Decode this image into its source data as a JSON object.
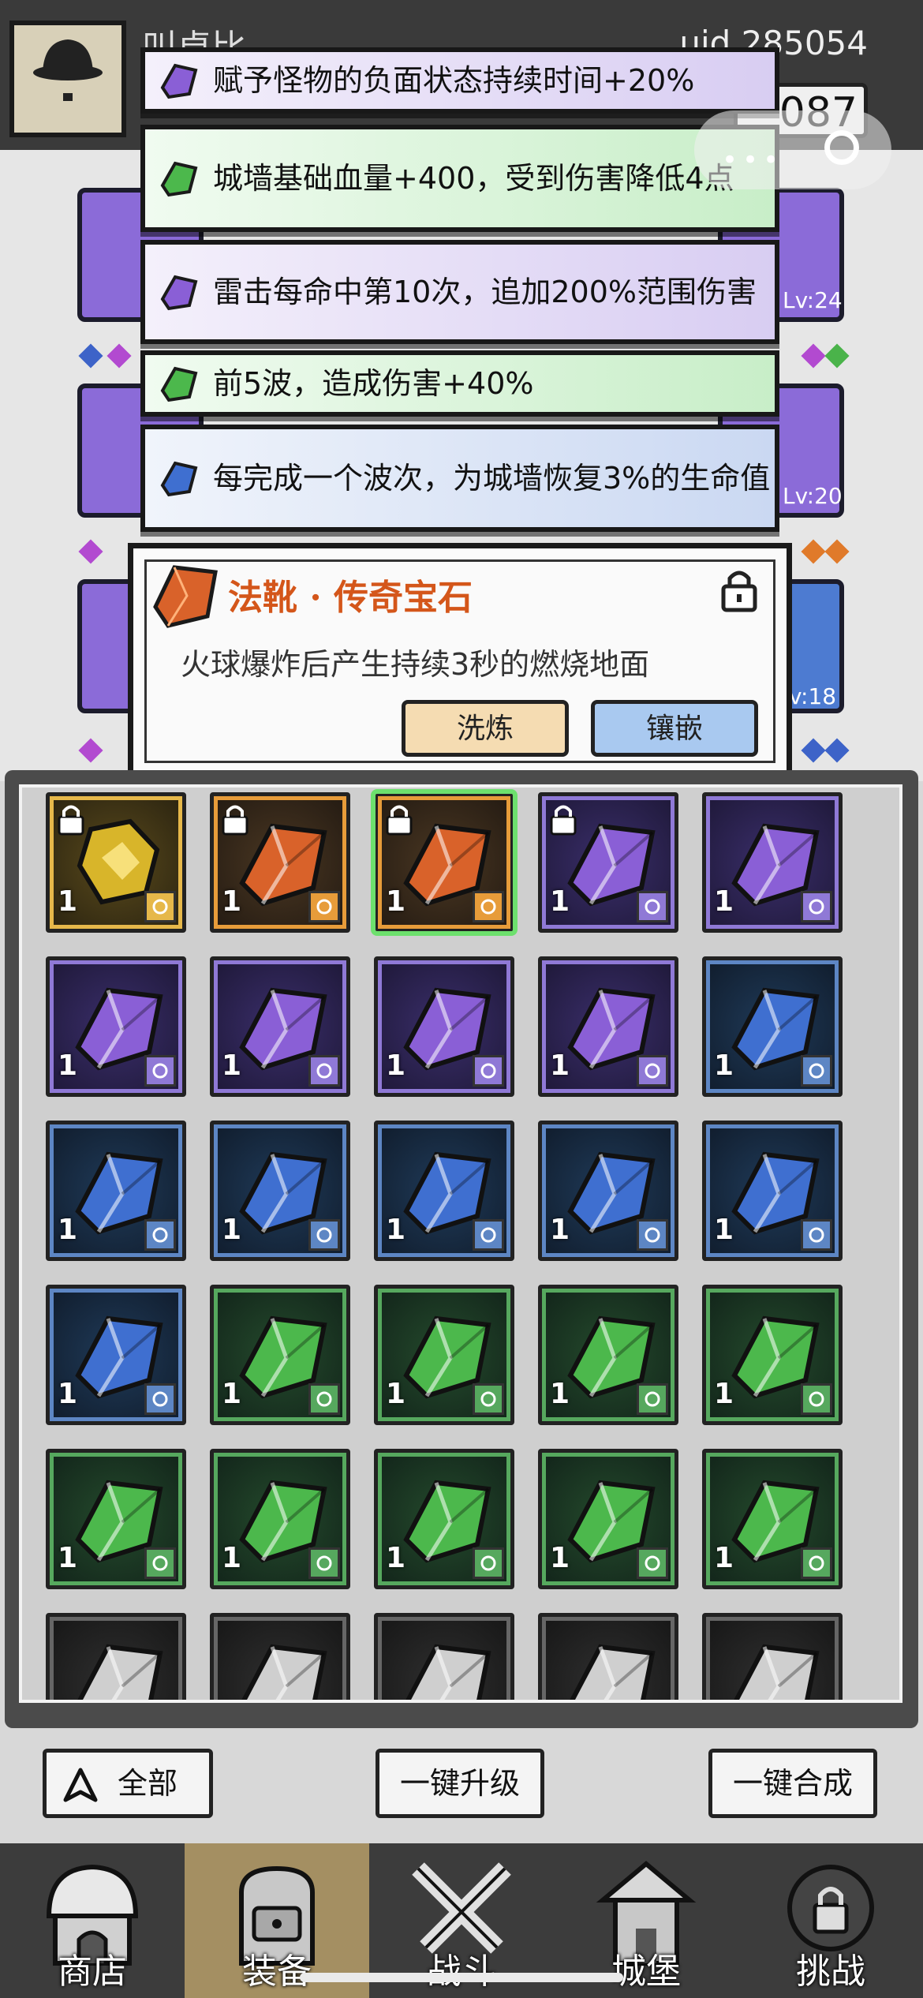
{
  "header": {
    "player_name": "叫卓比",
    "uid": "uid 285054",
    "currency": "087"
  },
  "affixes": [
    {
      "color": "purple",
      "text": "赋予怪物的负面状态持续时间+20%"
    },
    {
      "color": "green",
      "text": "城墙基础血量+400，受到伤害降低4点"
    },
    {
      "color": "purple",
      "text": "雷击每命中第10次，追加200%范围伤害"
    },
    {
      "color": "green",
      "text": "前5波，造成伤害+40%"
    },
    {
      "color": "blue",
      "text": "每完成一个波次，为城墙恢复3%的生命值"
    }
  ],
  "equipment_levels": [
    "Lv:24",
    "Lv:20",
    "v:18"
  ],
  "gem_dialog": {
    "title": "法靴 · 传奇宝石",
    "description": "火球爆炸后产生持续3秒的燃烧地面",
    "refine_label": "洗炼",
    "inlay_label": "镶嵌",
    "locked": true
  },
  "inventory": {
    "rows": [
      [
        {
          "rarity": "gold",
          "count": "1",
          "slot": "ring",
          "locked": true
        },
        {
          "rarity": "orange",
          "count": "1",
          "slot": "ring",
          "locked": true
        },
        {
          "rarity": "orange",
          "count": "1",
          "slot": "boots",
          "locked": true,
          "selected": true
        },
        {
          "rarity": "purple",
          "count": "1",
          "slot": "ring",
          "locked": true
        },
        {
          "rarity": "purple",
          "count": "1",
          "slot": "armor",
          "locked": false
        }
      ],
      [
        {
          "rarity": "purple",
          "count": "1",
          "slot": "armor"
        },
        {
          "rarity": "purple",
          "count": "1",
          "slot": "hat"
        },
        {
          "rarity": "purple",
          "count": "1",
          "slot": "hat"
        },
        {
          "rarity": "purple",
          "count": "1",
          "slot": "necklace"
        },
        {
          "rarity": "blue",
          "count": "1",
          "slot": "ring"
        }
      ],
      [
        {
          "rarity": "blue",
          "count": "1",
          "slot": "armor"
        },
        {
          "rarity": "blue",
          "count": "1",
          "slot": "staff"
        },
        {
          "rarity": "blue",
          "count": "1",
          "slot": "hat"
        },
        {
          "rarity": "blue",
          "count": "1",
          "slot": "hat"
        },
        {
          "rarity": "blue",
          "count": "1",
          "slot": "hat"
        }
      ],
      [
        {
          "rarity": "blue",
          "count": "1",
          "slot": "necklace"
        },
        {
          "rarity": "green",
          "count": "1",
          "slot": "ring"
        },
        {
          "rarity": "green",
          "count": "1",
          "slot": "armor"
        },
        {
          "rarity": "green",
          "count": "1",
          "slot": "armor"
        },
        {
          "rarity": "green",
          "count": "1",
          "slot": "armor"
        }
      ],
      [
        {
          "rarity": "green",
          "count": "1",
          "slot": "boots"
        },
        {
          "rarity": "green",
          "count": "1",
          "slot": "boots"
        },
        {
          "rarity": "green",
          "count": "1",
          "slot": "boots"
        },
        {
          "rarity": "green",
          "count": "1",
          "slot": "hat"
        },
        {
          "rarity": "green",
          "count": "1",
          "slot": "hat"
        }
      ],
      [
        {
          "rarity": "gray",
          "count": "",
          "slot": ""
        },
        {
          "rarity": "gray",
          "count": "",
          "slot": ""
        },
        {
          "rarity": "gray",
          "count": "",
          "slot": ""
        },
        {
          "rarity": "gray",
          "count": "",
          "slot": ""
        },
        {
          "rarity": "gray",
          "count": "",
          "slot": ""
        }
      ]
    ]
  },
  "actions": {
    "filter_label": "全部",
    "upgrade_all_label": "一键升级",
    "merge_all_label": "一键合成"
  },
  "nav": [
    {
      "label": "商店",
      "icon": "shop-icon"
    },
    {
      "label": "装备",
      "icon": "backpack-icon",
      "active": true
    },
    {
      "label": "战斗",
      "icon": "crossed-swords-icon"
    },
    {
      "label": "城堡",
      "icon": "castle-icon"
    },
    {
      "label": "挑战",
      "icon": "challenge-icon"
    }
  ],
  "colors": {
    "gold": "#e6b84a",
    "orange": "#e79c3a",
    "purple": "#8f79d6",
    "blue": "#5d86c4",
    "green": "#56a85e",
    "gray": "#666666"
  }
}
